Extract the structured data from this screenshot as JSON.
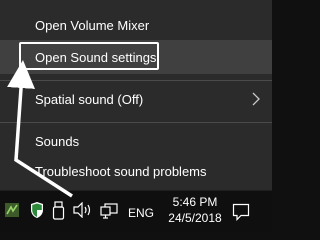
{
  "menu": {
    "items": [
      {
        "label": "Open Volume Mixer"
      },
      {
        "label": "Open Sound settings"
      },
      {
        "label": "Spatial sound (Off)"
      },
      {
        "label": "Sounds"
      },
      {
        "label": "Troubleshoot sound problems"
      }
    ]
  },
  "taskbar": {
    "language": "ENG",
    "time": "5:46 PM",
    "date": "24/5/2018",
    "icons": [
      "app-icon",
      "security-shield-icon",
      "usb-device-icon",
      "volume-icon",
      "network-icon",
      "notification-icon"
    ]
  },
  "colors": {
    "menu_bg": "#2b2b2b",
    "menu_highlight": "#404040",
    "taskbar_bg": "#0f0f0f",
    "annotation": "#ffffff"
  }
}
